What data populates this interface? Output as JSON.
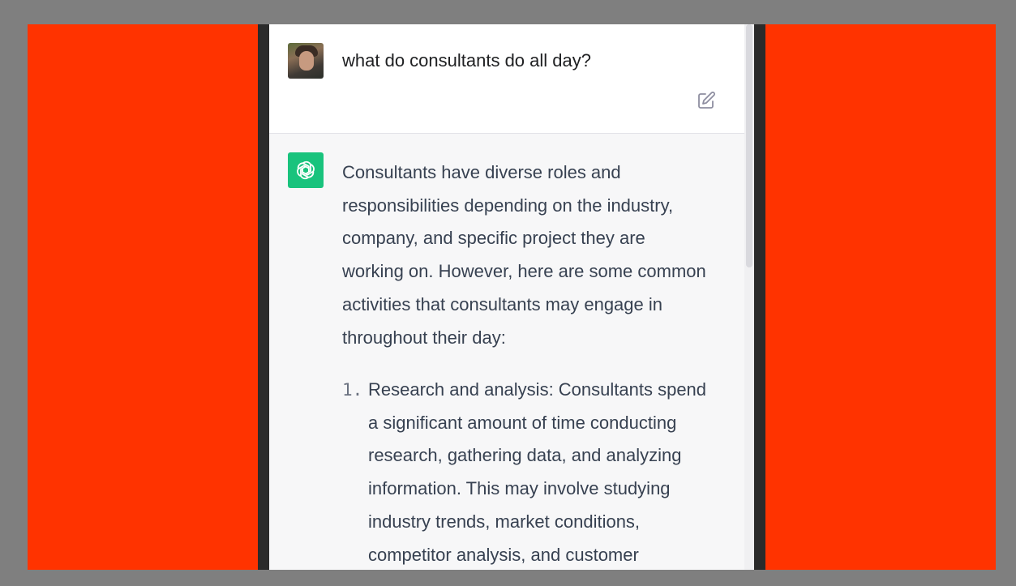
{
  "user_message": {
    "text": "what do consultants do all day?"
  },
  "assistant_message": {
    "intro_lines": [
      "Consultants have diverse roles and",
      "responsibilities depending on the industry,",
      "company, and specific project they are",
      "working on. However, here are some common",
      "activities that consultants may engage in",
      "throughout their day:"
    ],
    "list_items": [
      {
        "number": "1.",
        "lines": [
          "Research and analysis: Consultants spend",
          "a significant amount of time conducting",
          "research, gathering data, and analyzing",
          "information. This may involve studying",
          "industry trends, market conditions,",
          "competitor analysis, and customer"
        ]
      }
    ]
  },
  "icons": {
    "edit": "edit-icon",
    "assistant_logo": "openai-logo-icon",
    "user_avatar": "user-avatar"
  },
  "colors": {
    "background_outer": "#7f7f7f",
    "background_stage": "#ff3300",
    "assistant_logo_bg": "#19c37d",
    "assistant_row_bg": "#f7f7f8",
    "text_primary": "#374151"
  }
}
